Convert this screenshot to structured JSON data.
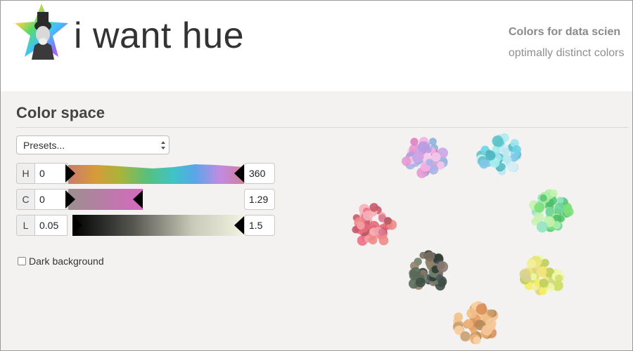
{
  "header": {
    "app_name": "i want hue",
    "tagline_bold": "Colors for data scien",
    "tagline": "optimally distinct colors",
    "logo_icon": "uncle-sam-rainbow-star-icon"
  },
  "color_space": {
    "title": "Color space",
    "presets": {
      "selected": "Presets..."
    },
    "h": {
      "label": "H",
      "min": "0",
      "max": "360"
    },
    "c": {
      "label": "C",
      "min": "0",
      "max": "1.29"
    },
    "l": {
      "label": "L",
      "min": "0.05",
      "max": "1.5"
    },
    "dark_background": {
      "label": "Dark background",
      "checked": false
    }
  },
  "clusters": [
    {
      "name": "pink-lilac",
      "colors": [
        "#e69ad2",
        "#c9a6e8",
        "#f2b3e4",
        "#a8b4e6",
        "#e07fc2",
        "#b79de0",
        "#f7c6ea",
        "#8fb3da"
      ]
    },
    {
      "name": "cyan",
      "colors": [
        "#9fe3ee",
        "#6fd3e4",
        "#bde6f2",
        "#5ec2c8",
        "#d6eef4",
        "#82c8e8",
        "#a8f0ee",
        "#4fb7c0"
      ]
    },
    {
      "name": "red-pink",
      "colors": [
        "#e36c7a",
        "#f08a8a",
        "#c95a6a",
        "#f4a0a6",
        "#d97b95",
        "#b95a60",
        "#ee6f86",
        "#f6b0b8"
      ]
    },
    {
      "name": "green",
      "colors": [
        "#7ee07a",
        "#a8f0a8",
        "#58c878",
        "#c6f2b0",
        "#6fd69a",
        "#92e4c2",
        "#4fbf6a",
        "#b4e78f"
      ]
    },
    {
      "name": "dark-mixed",
      "colors": [
        "#5a6a5a",
        "#7a6e60",
        "#3f4f45",
        "#8a7a70",
        "#6a7f6a",
        "#4a5560",
        "#93826a",
        "#2f3b33"
      ]
    },
    {
      "name": "yellow",
      "colors": [
        "#e7e67a",
        "#f2f09a",
        "#cfe06a",
        "#f6ec60",
        "#d8d28e",
        "#eef7a8",
        "#bfcf5a",
        "#f3e37e"
      ]
    },
    {
      "name": "orange",
      "colors": [
        "#e8a86a",
        "#f2c08a",
        "#d9905a",
        "#f6c89a",
        "#c9a070",
        "#eeb37a",
        "#b88a5a",
        "#f9d2a6"
      ]
    }
  ]
}
